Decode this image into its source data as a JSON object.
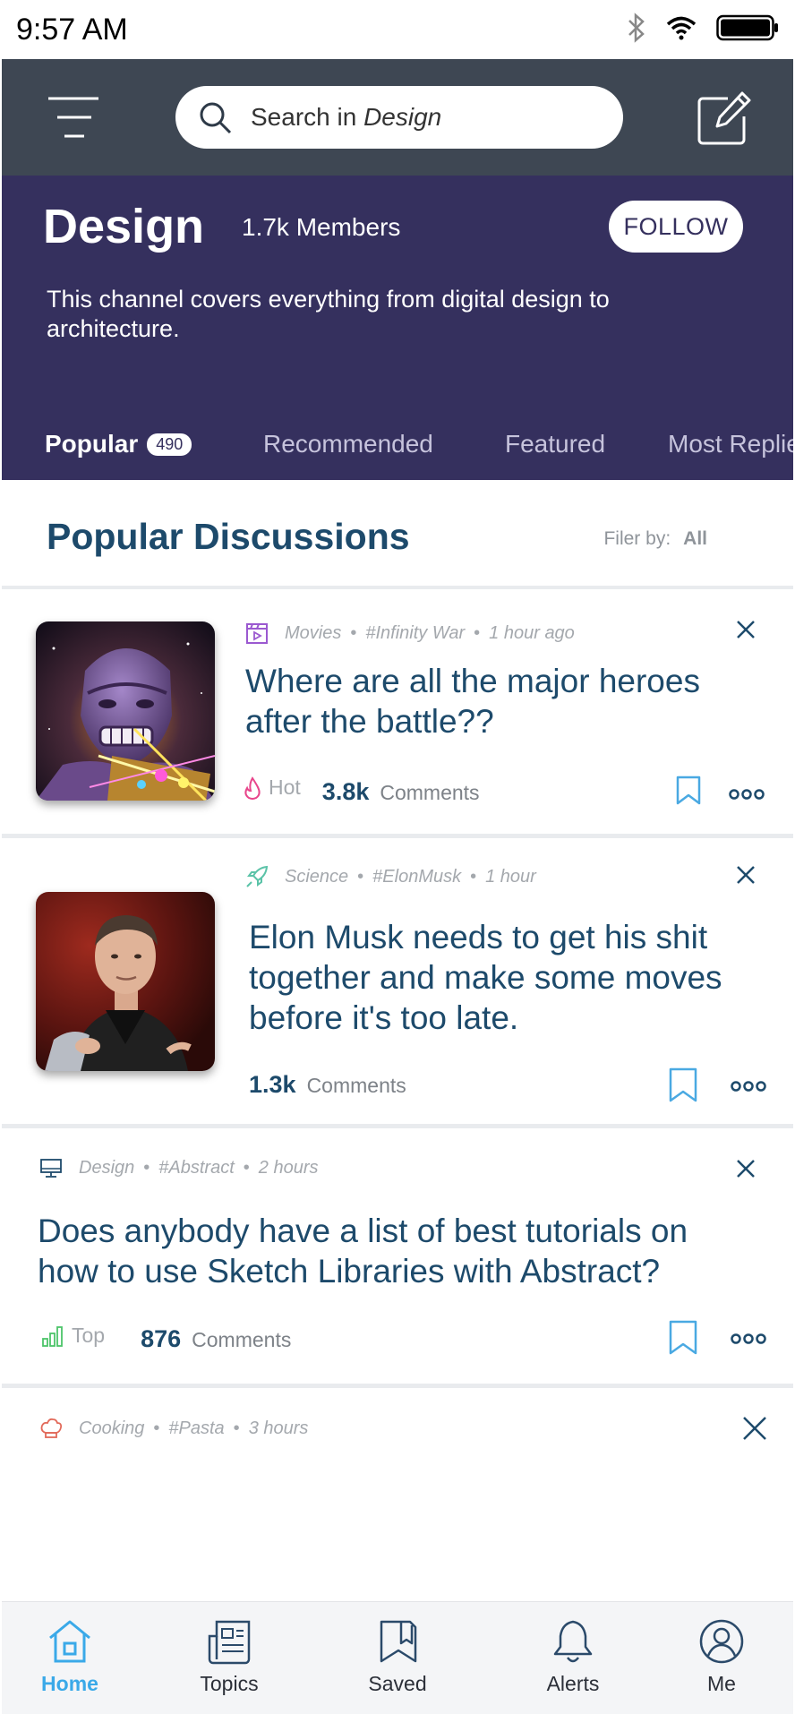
{
  "status_bar": {
    "time": "9:57 AM"
  },
  "header": {
    "search_prefix": "Search in ",
    "search_channel": "Design"
  },
  "channel": {
    "title": "Design",
    "members": "1.7k Members",
    "follow_label": "FOLLOW",
    "description": "This channel covers everything from digital design to architecture."
  },
  "tabs": [
    {
      "label": "Popular",
      "badge": "490",
      "active": true
    },
    {
      "label": "Recommended"
    },
    {
      "label": "Featured"
    },
    {
      "label": "Most Replied"
    }
  ],
  "section": {
    "title": "Popular Discussions",
    "filter_label": "Filer by:",
    "filter_value": "All"
  },
  "posts": [
    {
      "category": "Movies",
      "category_icon": "clapperboard-icon",
      "tag": "#Infinity War",
      "time": "1 hour ago",
      "title": "Where are all the major heroes after the battle??",
      "badge": "Hot",
      "badge_icon": "flame-icon",
      "count": "3.8k",
      "count_label": "Comments"
    },
    {
      "category": "Science",
      "category_icon": "rocket-icon",
      "tag": "#ElonMusk",
      "time": "1 hour",
      "title": "Elon Musk needs to get his shit together and make some moves before it's too late.",
      "count": "1.3k",
      "count_label": "Comments"
    },
    {
      "category": "Design",
      "category_icon": "monitor-icon",
      "tag": "#Abstract",
      "time": "2 hours",
      "title": "Does anybody have a list of best tutorials on how to use Sketch Libraries with Abstract?",
      "badge": "Top",
      "badge_icon": "bar-chart-icon",
      "count": "876",
      "count_label": "Comments"
    },
    {
      "category": "Cooking",
      "category_icon": "chef-hat-icon",
      "tag": "#Pasta",
      "time": "3 hours"
    }
  ],
  "bottom_nav": [
    {
      "label": "Home",
      "icon": "home-icon",
      "active": true
    },
    {
      "label": "Topics",
      "icon": "newspaper-icon"
    },
    {
      "label": "Saved",
      "icon": "bookmark-icon"
    },
    {
      "label": "Alerts",
      "icon": "bell-icon"
    },
    {
      "label": "Me",
      "icon": "user-circle-icon"
    }
  ],
  "colors": {
    "header_bg": "#3e4753",
    "channel_bg": "#35305e",
    "title_text": "#1d4a6b",
    "accent_blue": "#3aa9e8",
    "hot_pink": "#e8458b",
    "top_green": "#4cc46a"
  }
}
